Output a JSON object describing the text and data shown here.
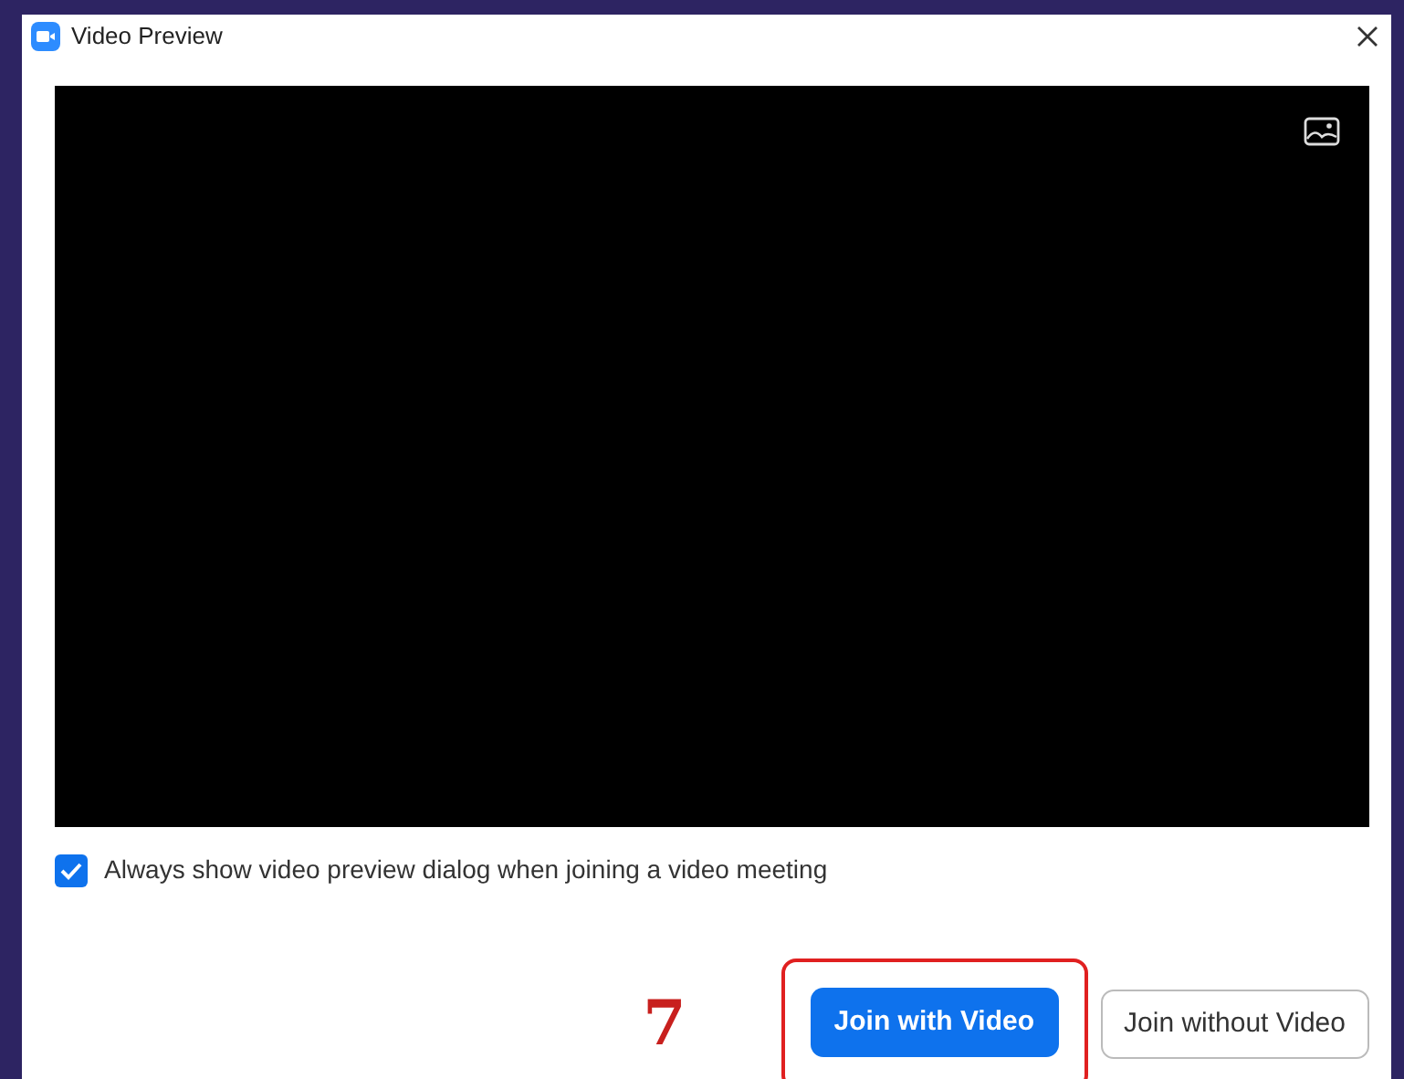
{
  "window": {
    "title": "Video Preview"
  },
  "checkbox": {
    "label": "Always show video preview dialog when joining a video meeting",
    "checked": true
  },
  "step_marker": "7",
  "buttons": [
    {
      "label": "Join with Video",
      "kind": "primary",
      "highlighted": true
    },
    {
      "label": "Join without Video",
      "kind": "secondary",
      "highlighted": false
    }
  ]
}
